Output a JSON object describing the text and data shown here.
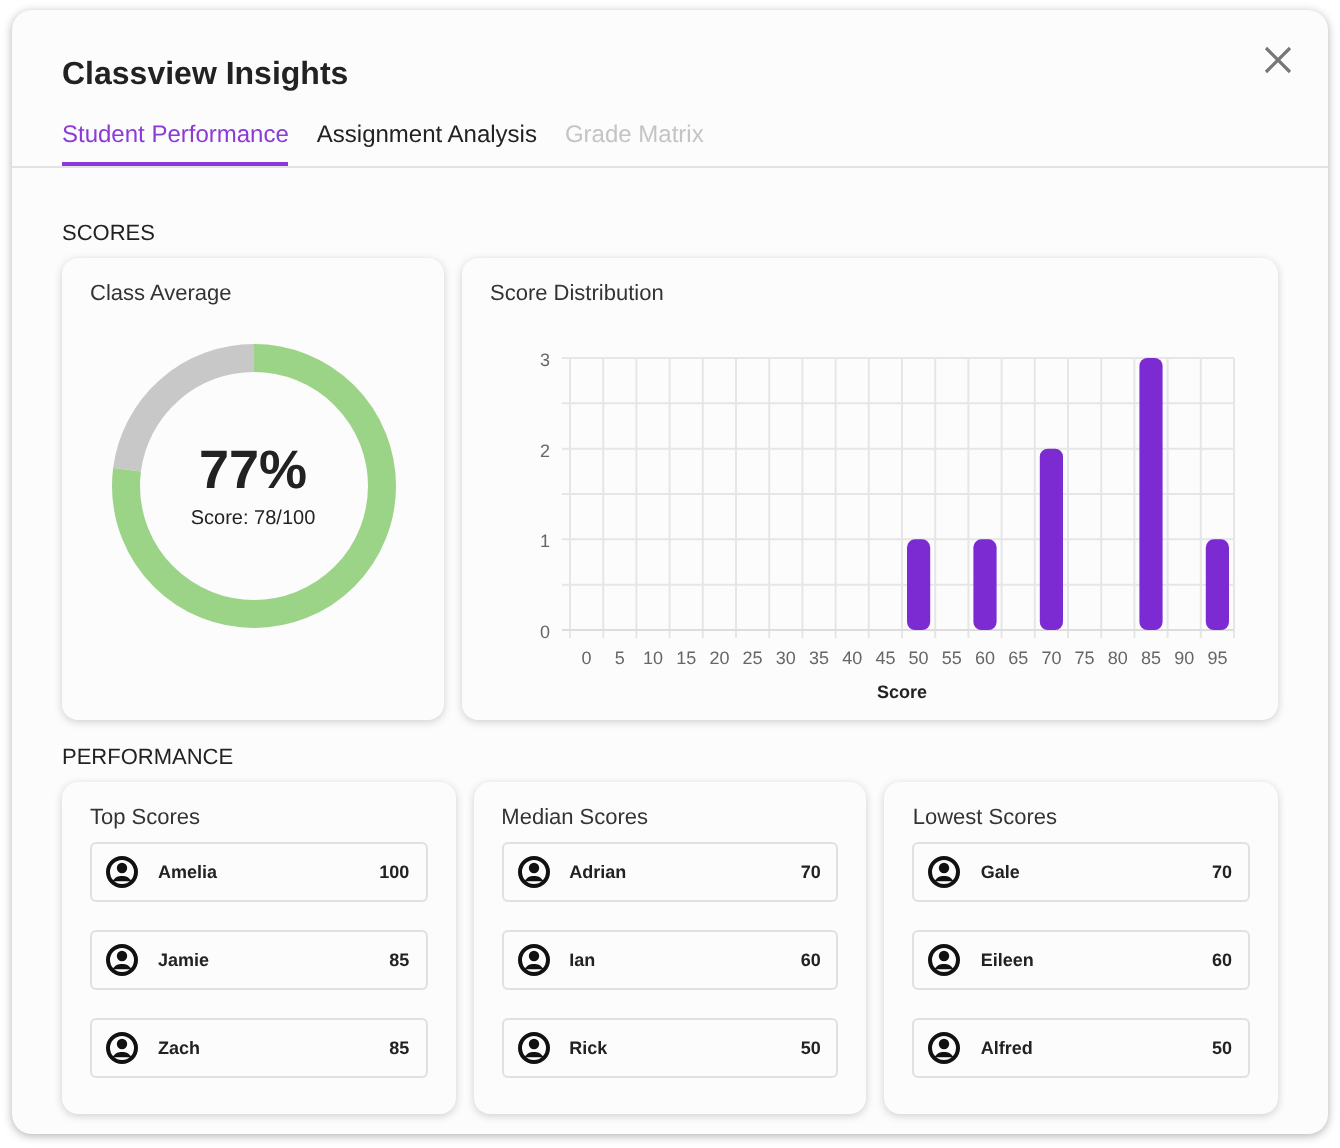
{
  "window": {
    "title": "Classview Insights"
  },
  "tabs": [
    {
      "label": "Student Performance",
      "selected": true,
      "disabled": false
    },
    {
      "label": "Assignment Analysis",
      "selected": false,
      "disabled": false
    },
    {
      "label": "Grade Matrix",
      "selected": false,
      "disabled": true
    }
  ],
  "scores": {
    "heading": "SCORES",
    "class_average": {
      "title": "Class Average",
      "percent": "77%",
      "score": "Score: 78/100"
    },
    "distribution": {
      "title": "Score Distribution",
      "chart_data": {
        "type": "bar",
        "xlabel": "Score",
        "categories": [
          "0",
          "5",
          "10",
          "15",
          "20",
          "25",
          "30",
          "35",
          "40",
          "45",
          "50",
          "55",
          "60",
          "65",
          "70",
          "75",
          "80",
          "85",
          "90",
          "95"
        ],
        "series": [
          {
            "color": "#7b2bd1",
            "values": [
              0,
              0,
              0,
              0,
              0,
              0,
              0,
              0,
              0,
              0,
              1,
              0,
              1,
              0,
              2,
              0,
              0,
              3,
              0,
              1
            ]
          }
        ],
        "ylim": [
          0,
          3
        ],
        "yticks": [
          0,
          1,
          2,
          3
        ]
      }
    }
  },
  "performance": {
    "heading": "PERFORMANCE",
    "groups": [
      {
        "title": "Top Scores",
        "students": [
          {
            "name": "Amelia",
            "score": "100"
          },
          {
            "name": "Jamie",
            "score": "85"
          },
          {
            "name": "Zach",
            "score": "85"
          }
        ]
      },
      {
        "title": "Median Scores",
        "students": [
          {
            "name": "Adrian",
            "score": "70"
          },
          {
            "name": "Ian",
            "score": "60"
          },
          {
            "name": "Rick",
            "score": "50"
          }
        ]
      },
      {
        "title": "Lowest Scores",
        "students": [
          {
            "name": "Gale",
            "score": "70"
          },
          {
            "name": "Eileen",
            "score": "60"
          },
          {
            "name": "Alfred",
            "score": "50"
          }
        ]
      }
    ]
  }
}
